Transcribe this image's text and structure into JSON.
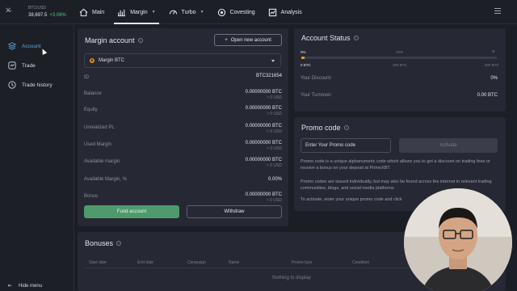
{
  "ticker": {
    "pair": "BTC/USD",
    "price": "38,697.5",
    "change": "+3.06%"
  },
  "nav": [
    {
      "label": "Main",
      "icon": "home-icon"
    },
    {
      "label": "Margin",
      "icon": "chart-icon",
      "active": true
    },
    {
      "label": "Turbo",
      "icon": "speedometer-icon"
    },
    {
      "label": "Covesting",
      "icon": "covesting-icon"
    },
    {
      "label": "Analysis",
      "icon": "analysis-icon"
    }
  ],
  "sidebar": {
    "items": [
      {
        "label": "Account",
        "icon": "layers-icon",
        "active": true
      },
      {
        "label": "Trade",
        "icon": "trade-icon"
      },
      {
        "label": "Trade history",
        "icon": "clock-icon"
      }
    ],
    "hide_menu": "Hide menu"
  },
  "margin_account": {
    "title": "Margin account",
    "open_button": "Open new account",
    "selected_account": "Margin BTC",
    "rows": [
      {
        "label": "ID",
        "value": "BTC321654",
        "sub": ""
      },
      {
        "label": "Balance",
        "value": "0.00000000 BTC",
        "sub": "≈ 0 USD"
      },
      {
        "label": "Equity",
        "value": "0.00000000 BTC",
        "sub": "≈ 0 USD"
      },
      {
        "label": "Unrealized PL",
        "value": "0.00000000 BTC",
        "sub": "≈ 0 USD"
      },
      {
        "label": "Used Margin",
        "value": "0.00000000 BTC",
        "sub": "≈ 0 USD"
      },
      {
        "label": "Available margin",
        "value": "0.00000000 BTC",
        "sub": "≈ 0 USD"
      },
      {
        "label": "Available Margin, %",
        "value": "0.00%",
        "sub": ""
      },
      {
        "label": "Bonus",
        "value": "0.00000000 BTC",
        "sub": "≈ 0 USD"
      }
    ],
    "fund_button": "Fund account",
    "withdraw_button": "Withdraw"
  },
  "account_status": {
    "title": "Account Status",
    "progress_fraction": 0.0,
    "tiers": [
      {
        "pct": "0%",
        "amount": "0 BTC"
      },
      {
        "pct": "20%",
        "amount": "300 BTC"
      },
      {
        "pct": "",
        "amount": "600 BTC"
      }
    ],
    "discount_label": "Your Discount:",
    "discount_value": "0%",
    "turnover_label": "Your Turnover:",
    "turnover_value": "0.00 BTC"
  },
  "promo": {
    "title": "Promo code",
    "placeholder": "Enter Your Promo code",
    "activate": "Activate",
    "p1": "Promo code is a unique alphanumeric code which allows you to get a discount on trading fees or receive a bonus on your deposit at PrimeXBT.",
    "p2": "Promo codes are issued individually, but may also be found across the internet in relevant trading communities, blogs, and social media platforms.",
    "p3": "To activate, enter your unique promo code and click"
  },
  "bonuses": {
    "title": "Bonuses",
    "columns": [
      "Start date",
      "End date",
      "Campaign",
      "Name",
      "Promo type",
      "Condition"
    ],
    "empty": "Nothing to display"
  },
  "colors": {
    "accent_blue": "#5aa7e8",
    "positive": "#4fc27a",
    "btc_orange": "#e8912a",
    "fund_green": "#4f9a6c"
  }
}
